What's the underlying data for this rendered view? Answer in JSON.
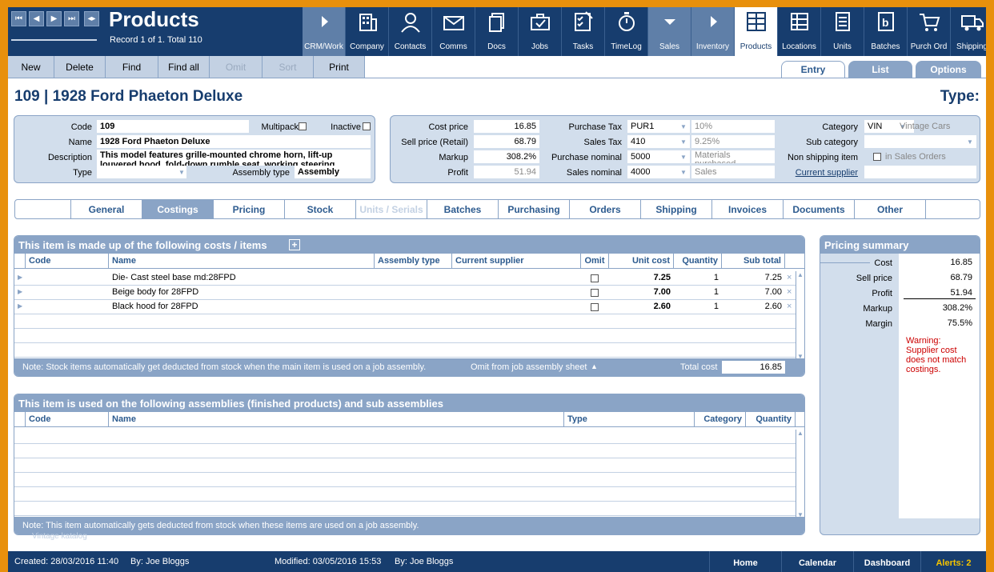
{
  "app": {
    "title": "Products",
    "record_info": "Record 1 of 1. Total 110"
  },
  "nav": [
    {
      "label": "CRM/Work",
      "icon": "chevron-right-icon"
    },
    {
      "label": "Company",
      "icon": "building-icon"
    },
    {
      "label": "Contacts",
      "icon": "person-icon"
    },
    {
      "label": "Comms",
      "icon": "envelope-icon"
    },
    {
      "label": "Docs",
      "icon": "documents-icon"
    },
    {
      "label": "Jobs",
      "icon": "briefcase-icon"
    },
    {
      "label": "Tasks",
      "icon": "checklist-icon"
    },
    {
      "label": "TimeLog",
      "icon": "stopwatch-icon"
    },
    {
      "label": "Sales",
      "icon": "chevron-down-icon"
    },
    {
      "label": "Inventory",
      "icon": "chevron-right-icon"
    },
    {
      "label": "Products",
      "icon": "shelves-icon"
    },
    {
      "label": "Locations",
      "icon": "locations-icon"
    },
    {
      "label": "Units",
      "icon": "list-icon"
    },
    {
      "label": "Batches",
      "icon": "batch-icon"
    },
    {
      "label": "Purch Ord",
      "icon": "cart-icon"
    },
    {
      "label": "Shipping",
      "icon": "truck-icon"
    }
  ],
  "toolbar": {
    "new": "New",
    "delete": "Delete",
    "find": "Find",
    "find_all": "Find all",
    "omit": "Omit",
    "sort": "Sort",
    "print": "Print"
  },
  "view_tabs": {
    "entry": "Entry",
    "list": "List",
    "options": "Options"
  },
  "item": {
    "title": "109 | 1928 Ford Phaeton Deluxe",
    "type_label": "Type:"
  },
  "details": {
    "code_label": "Code",
    "code": "109",
    "multipack_label": "Multipack",
    "inactive_label": "Inactive",
    "name_label": "Name",
    "name": "1928 Ford Phaeton Deluxe",
    "description_label": "Description",
    "description": "This model features grille-mounted chrome horn, lift-up louvered hood, fold-down rumble seat, working steering",
    "type_field_label": "Type",
    "assembly_type_label": "Assembly type",
    "assembly_type": "Assembly"
  },
  "pricing_block": {
    "cost_price_label": "Cost price",
    "cost_price": "16.85",
    "sell_price_label": "Sell price (Retail)",
    "sell_price": "68.79",
    "markup_label": "Markup",
    "markup": "308.2%",
    "profit_label": "Profit",
    "profit": "51.94",
    "purchase_tax_label": "Purchase Tax",
    "purchase_tax": "PUR1",
    "purchase_tax_rate": "10%",
    "sales_tax_label": "Sales Tax",
    "sales_tax": "410",
    "sales_tax_rate": "9.25%",
    "purchase_nominal_label": "Purchase nominal",
    "purchase_nominal": "5000",
    "purchase_nominal_name": "Materials purchased",
    "sales_nominal_label": "Sales nominal",
    "sales_nominal": "4000",
    "sales_nominal_name": "Sales"
  },
  "category_block": {
    "category_label": "Category",
    "category": "VIN",
    "category_name": "Vintage Cars",
    "sub_category_label": "Sub category",
    "non_shipping_label": "Non shipping item",
    "in_sales_orders": "in Sales Orders",
    "current_supplier_link": "Current supplier"
  },
  "subtabs": [
    "General",
    "Costings",
    "Pricing",
    "Stock",
    "Units / Serials",
    "Batches",
    "Purchasing",
    "Orders",
    "Shipping",
    "Invoices",
    "Documents",
    "Other"
  ],
  "costs_box": {
    "title": "This item is made up of the following costs / items",
    "columns": {
      "code": "Code",
      "name": "Name",
      "assembly_type": "Assembly type",
      "current_supplier": "Current supplier",
      "omit": "Omit",
      "unit_cost": "Unit cost",
      "quantity": "Quantity",
      "sub_total": "Sub total"
    },
    "rows": [
      {
        "name": "Die- Cast steel base md:28FPD",
        "unit_cost": "7.25",
        "quantity": "1",
        "sub_total": "7.25"
      },
      {
        "name": "Beige body for 28FPD",
        "unit_cost": "7.00",
        "quantity": "1",
        "sub_total": "7.00"
      },
      {
        "name": "Black hood for 28FPD",
        "unit_cost": "2.60",
        "quantity": "1",
        "sub_total": "2.60"
      }
    ],
    "note": "Note: Stock items automatically get deducted from stock when the main item is used on a job assembly.",
    "omit_link": "Omit from job assembly sheet",
    "total_cost_label": "Total cost",
    "total_cost": "16.85"
  },
  "assemblies_box": {
    "title": "This item is used on the following assemblies (finished products) and sub assemblies",
    "columns": {
      "code": "Code",
      "name": "Name",
      "type": "Type",
      "category": "Category",
      "quantity": "Quantity"
    },
    "note": "Note: This item automatically gets deducted from stock when these items are used on a job assembly."
  },
  "summary": {
    "title": "Pricing summary",
    "cost_label": "Cost",
    "cost": "16.85",
    "sell_price_label": "Sell price",
    "sell_price": "68.79",
    "profit_label": "Profit",
    "profit": "51.94",
    "markup_label": "Markup",
    "markup": "308.2%",
    "margin_label": "Margin",
    "margin": "75.5%",
    "warning": "Warning: Supplier cost does not match costings.",
    "warning_color": "#cc0000"
  },
  "watermark": "Vintage katalog",
  "status": {
    "created": "Created: 28/03/2016  11:40",
    "created_by": "By: Joe Bloggs",
    "modified": "Modified: 03/05/2016  15:53",
    "modified_by": "By: Joe Bloggs",
    "home": "Home",
    "calendar": "Calendar",
    "dashboard": "Dashboard",
    "alerts": "Alerts: 2",
    "alerts_color": "#f5c400"
  },
  "colors": {
    "header": "#173d6e",
    "accent": "#8aa4c6",
    "panel": "#d2deec",
    "border": "#e8900c"
  }
}
